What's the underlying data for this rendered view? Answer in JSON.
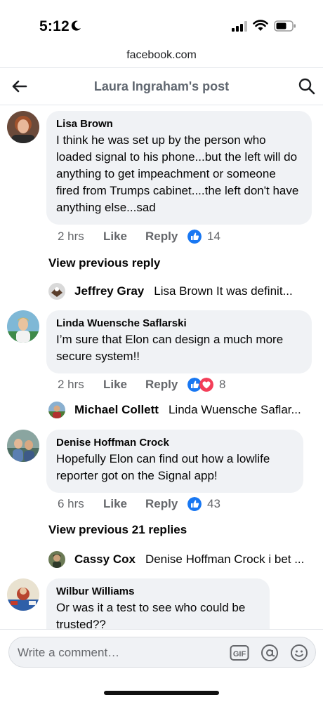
{
  "status_bar": {
    "time": "5:12"
  },
  "url": "facebook.com",
  "header": {
    "title": "Laura Ingraham's post"
  },
  "comments": [
    {
      "author": "Lisa Brown",
      "text": "I think he was set up by the person who loaded signal to his phone...but the left will do anything to get impeachment or someone fired from Trumps cabinet....the left don't have anything else...sad",
      "time": "2 hrs",
      "like": "Like",
      "reply": "Reply",
      "reactions": "14",
      "view_previous": "View previous reply",
      "reply_preview": {
        "author": "Jeffrey Gray",
        "text": "Lisa Brown It was definit..."
      }
    },
    {
      "author": "Linda Wuensche Saflarski",
      "text": "I’m sure that Elon can design a much more secure system!!",
      "time": "2 hrs",
      "like": "Like",
      "reply": "Reply",
      "reactions": "8",
      "reply_preview": {
        "author": "Michael Collett",
        "text": "Linda Wuensche Saflar..."
      }
    },
    {
      "author": "Denise Hoffman Crock",
      "text": "Hopefully Elon can find out how a lowlife reporter got on the Signal app!",
      "time": "6 hrs",
      "like": "Like",
      "reply": "Reply",
      "reactions": "43",
      "view_previous": "View previous 21 replies",
      "reply_preview": {
        "author": "Cassy Cox",
        "text": "Denise Hoffman Crock i bet ..."
      }
    },
    {
      "author": "Wilbur Williams",
      "text": "Or was it a test to see who could be trusted??"
    }
  ],
  "composer": {
    "placeholder": "Write a comment…",
    "gif_label": "GIF"
  },
  "colors": {
    "like_blue": "#1877f2",
    "love_red": "#f33e58",
    "bubble": "#f0f2f5",
    "meta_gray": "#65676b"
  }
}
